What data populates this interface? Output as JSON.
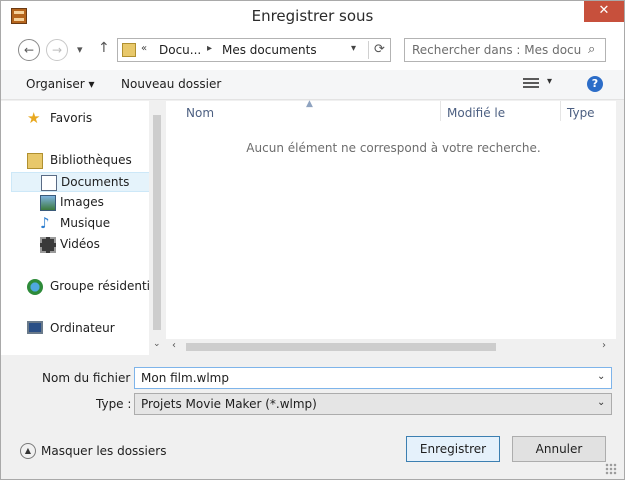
{
  "window": {
    "title": "Enregistrer sous",
    "close_label": "✕"
  },
  "nav": {
    "back": "←",
    "forward": "→",
    "history": "▾",
    "up": "↑",
    "address": {
      "overflow": "«",
      "crumbs": [
        "Docu...",
        "Mes documents"
      ],
      "sep": "▸",
      "dropdown": "▾",
      "refresh": "⟳"
    },
    "search_placeholder": "Rechercher dans : Mes docu...",
    "search_icon": "⌕"
  },
  "toolbar": {
    "organize": "Organiser ▾",
    "new_folder": "Nouveau dossier",
    "view_arrow": "▾",
    "help": "?"
  },
  "sidebar": {
    "items": [
      {
        "label": "Favoris",
        "icon": "star-icon"
      },
      {
        "label": "Bibliothèques",
        "icon": "libraries-icon"
      },
      {
        "label": "Documents",
        "icon": "documents-icon"
      },
      {
        "label": "Images",
        "icon": "images-icon"
      },
      {
        "label": "Musique",
        "icon": "music-icon"
      },
      {
        "label": "Vidéos",
        "icon": "videos-icon"
      },
      {
        "label": "Groupe résidentiel",
        "icon": "homegroup-icon"
      },
      {
        "label": "Ordinateur",
        "icon": "computer-icon"
      }
    ]
  },
  "content": {
    "columns": [
      "Nom",
      "Modifié le",
      "Type"
    ],
    "empty_message": "Aucun élément ne correspond à votre recherche."
  },
  "form": {
    "filename_label": "Nom du fichier :",
    "filename_value": "Mon film.wlmp",
    "type_label": "Type :",
    "type_value": "Projets Movie Maker (*.wlmp)"
  },
  "footer": {
    "hide_folders": "Masquer les dossiers",
    "save": "Enregistrer",
    "cancel": "Annuler"
  },
  "colors": {
    "accent": "#3c7fb1",
    "selection": "#e5f3fb",
    "close": "#c7503c"
  }
}
